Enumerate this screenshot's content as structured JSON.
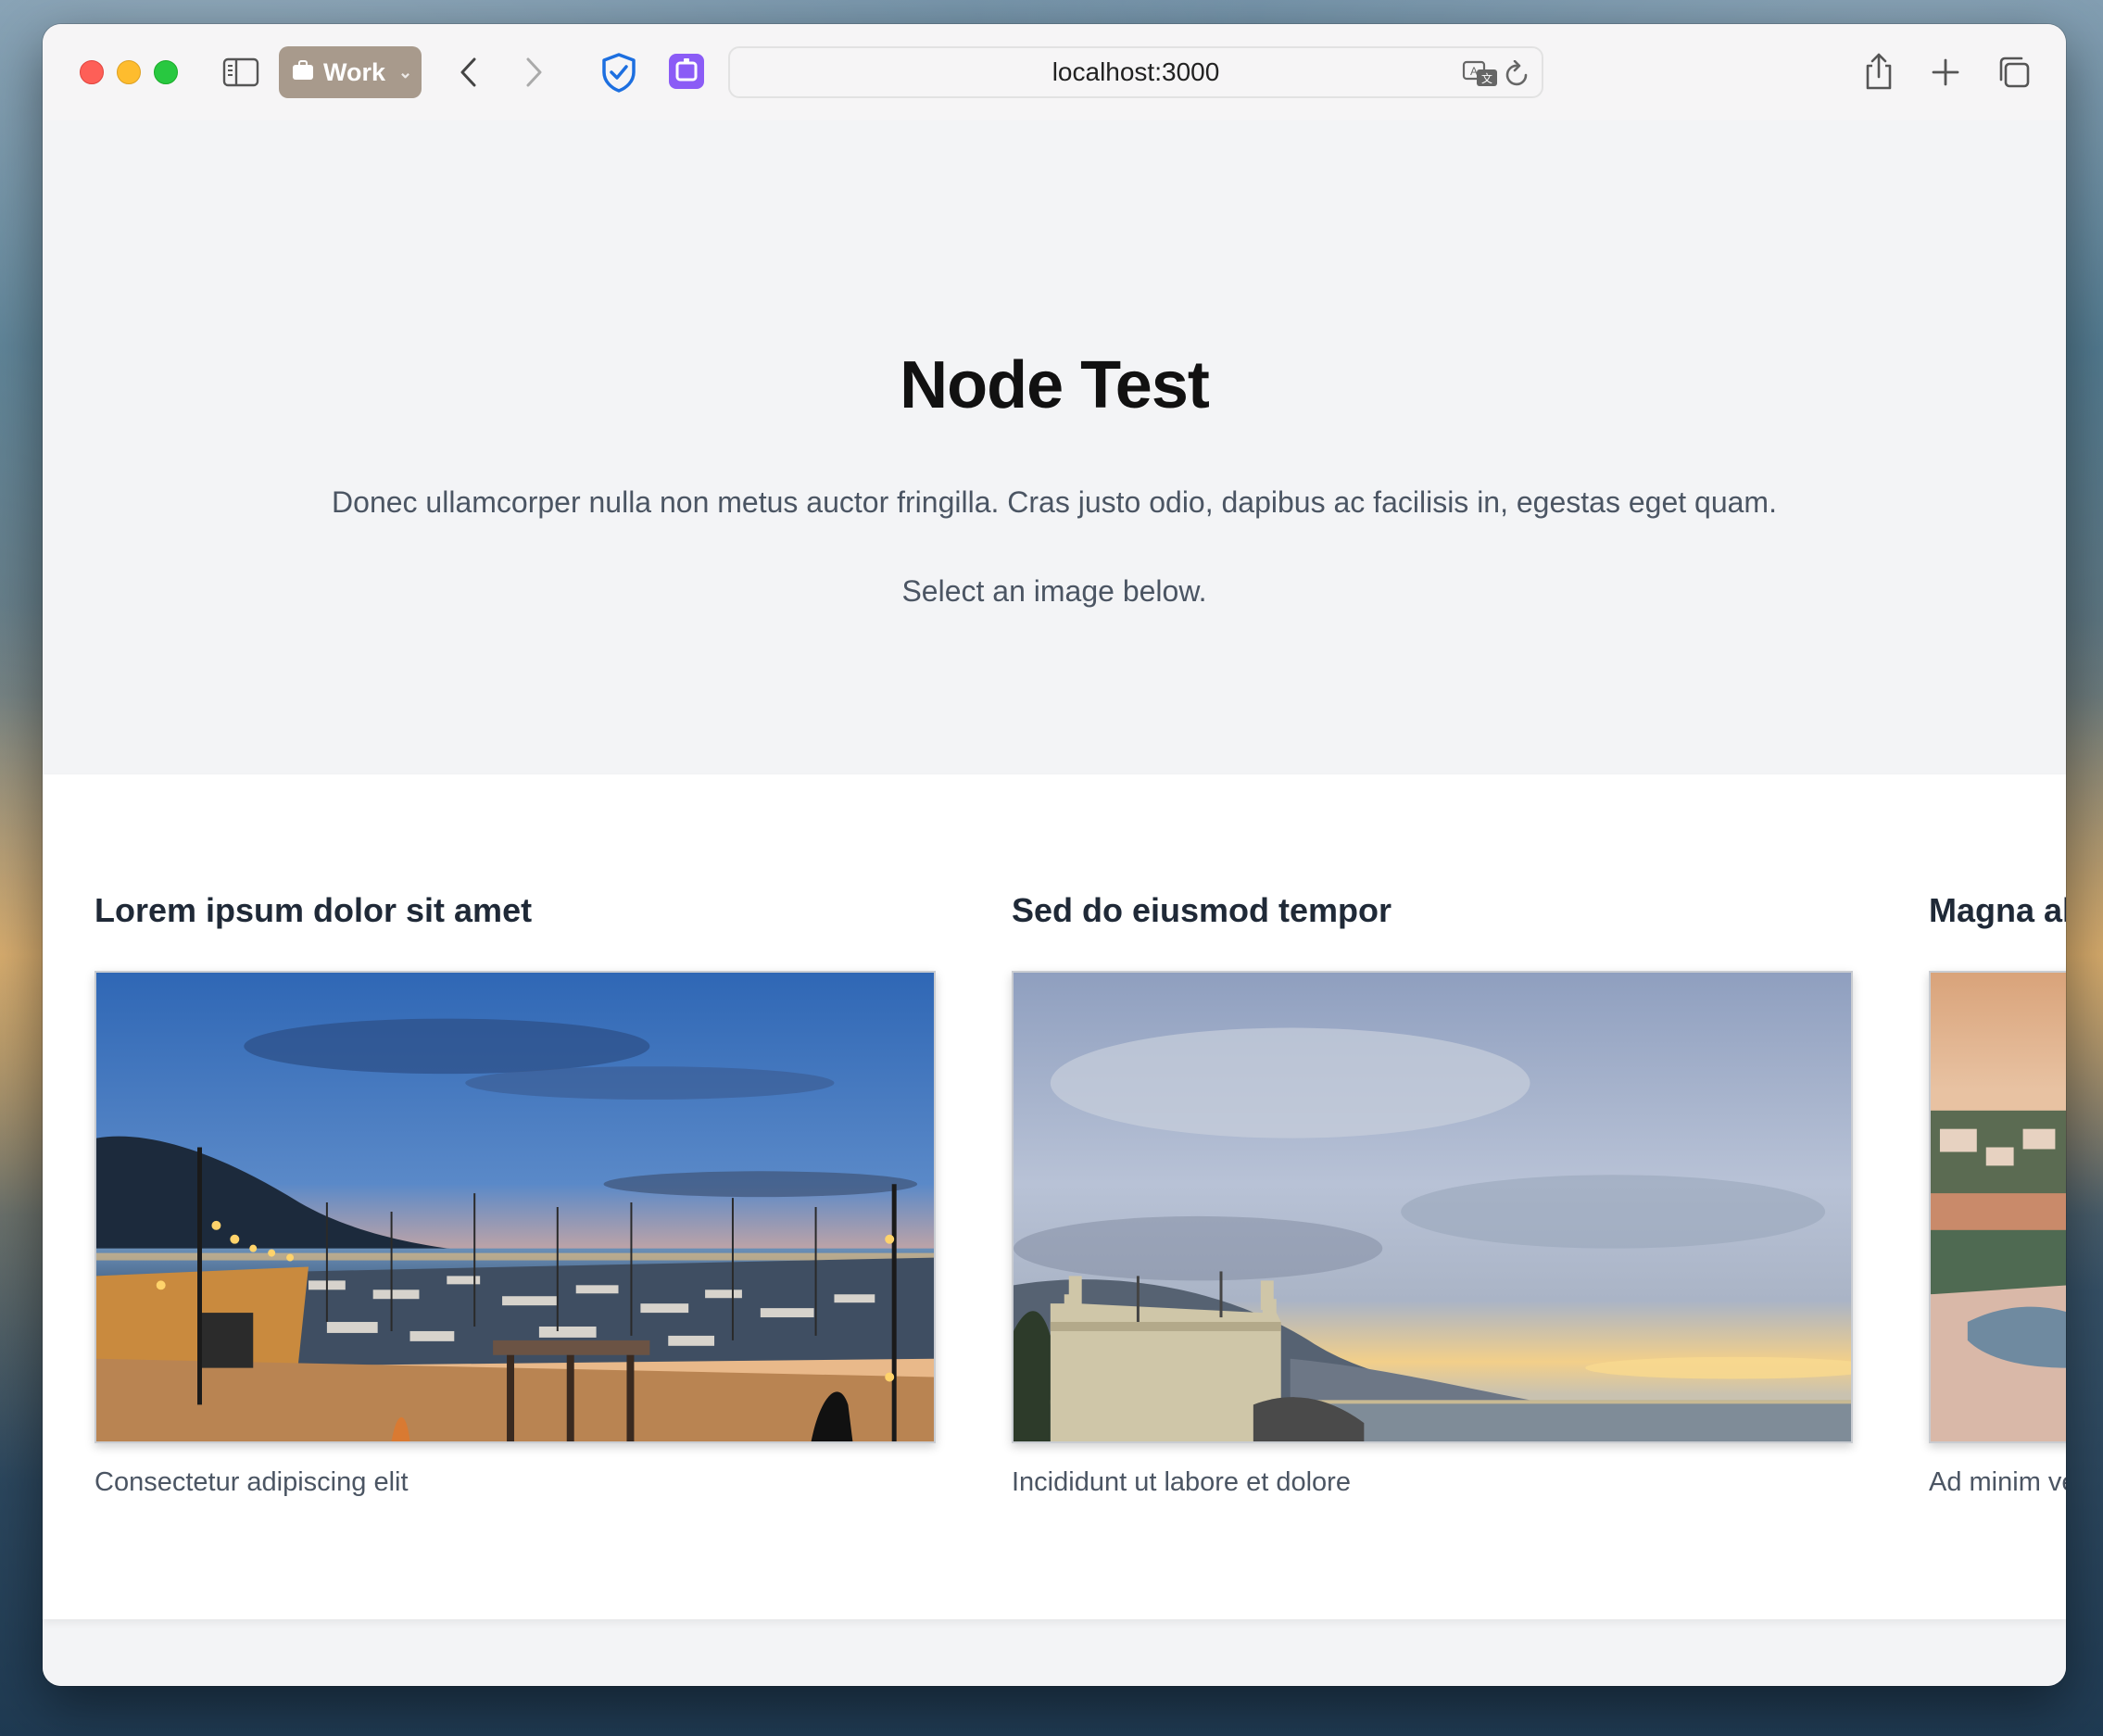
{
  "browser": {
    "tab_group_label": "Work",
    "url": "localhost:3000"
  },
  "page": {
    "title": "Node Test",
    "lead": "Donec ullamcorper nulla non metus auctor fringilla. Cras justo odio, dapibus ac facilisis in, egestas eget quam.",
    "instruction": "Select an image below."
  },
  "gallery": {
    "cards": [
      {
        "title": "Lorem ipsum dolor sit amet",
        "caption": "Consectetur adipiscing elit"
      },
      {
        "title": "Sed do eiusmod tempor",
        "caption": "Incididunt ut labore et dolore"
      },
      {
        "title": "Magna aliqua",
        "caption": "Ad minim veniam"
      }
    ]
  },
  "colors": {
    "tab_group": "#a89a8c",
    "shield_icon": "#1d6fe0",
    "extension_icon": "#8b5cf6"
  },
  "icons": [
    "sidebar-icon",
    "briefcase-icon",
    "chevron-down-icon",
    "back-icon",
    "forward-icon",
    "shield-icon",
    "extension-icon",
    "translate-icon",
    "reload-icon",
    "share-icon",
    "plus-icon",
    "tabs-icon"
  ]
}
